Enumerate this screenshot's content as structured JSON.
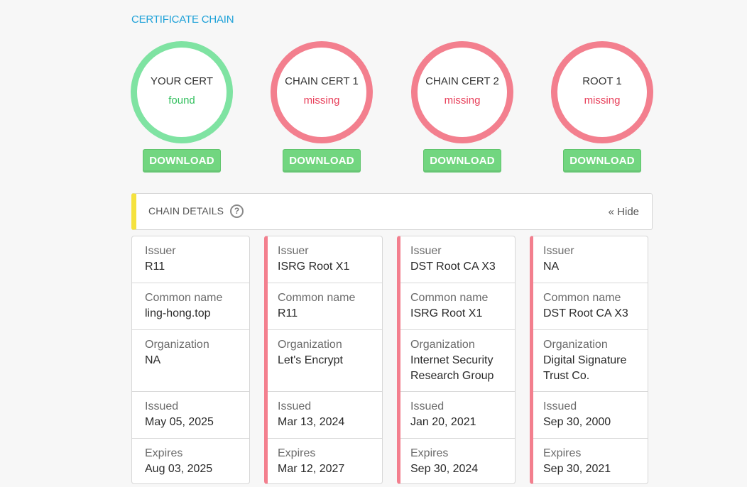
{
  "section_title": "CERTIFICATE CHAIN",
  "certs": [
    {
      "name": "YOUR CERT",
      "status": "found",
      "download": "DOWNLOAD"
    },
    {
      "name": "CHAIN CERT 1",
      "status": "missing",
      "download": "DOWNLOAD"
    },
    {
      "name": "CHAIN CERT 2",
      "status": "missing",
      "download": "DOWNLOAD"
    },
    {
      "name": "ROOT 1",
      "status": "missing",
      "download": "DOWNLOAD"
    }
  ],
  "details": {
    "title": "CHAIN DETAILS",
    "help": "?",
    "hide": "« Hide"
  },
  "labels": {
    "issuer": "Issuer",
    "common_name": "Common name",
    "organization": "Organization",
    "issued": "Issued",
    "expires": "Expires"
  },
  "columns": [
    {
      "issuer": "R11",
      "common_name": "ling-hong.top",
      "organization": "NA",
      "issued": "May 05, 2025",
      "expires": "Aug 03, 2025"
    },
    {
      "issuer": "ISRG Root X1",
      "common_name": "R11",
      "organization": "Let's Encrypt",
      "issued": "Mar 13, 2024",
      "expires": "Mar 12, 2027"
    },
    {
      "issuer": "DST Root CA X3",
      "common_name": "ISRG Root X1",
      "organization": "Internet Security Research Group",
      "issued": "Jan 20, 2021",
      "expires": "Sep 30, 2024"
    },
    {
      "issuer": "NA",
      "common_name": "DST Root CA X3",
      "organization": "Digital Signature Trust Co.",
      "issued": "Sep 30, 2000",
      "expires": "Sep 30, 2021"
    }
  ],
  "colors": {
    "found": "#7fe3a2",
    "missing": "#f37f8e",
    "accent": "#1ea1d8",
    "header_bar": "#f5e23e",
    "button": "#72d680"
  }
}
